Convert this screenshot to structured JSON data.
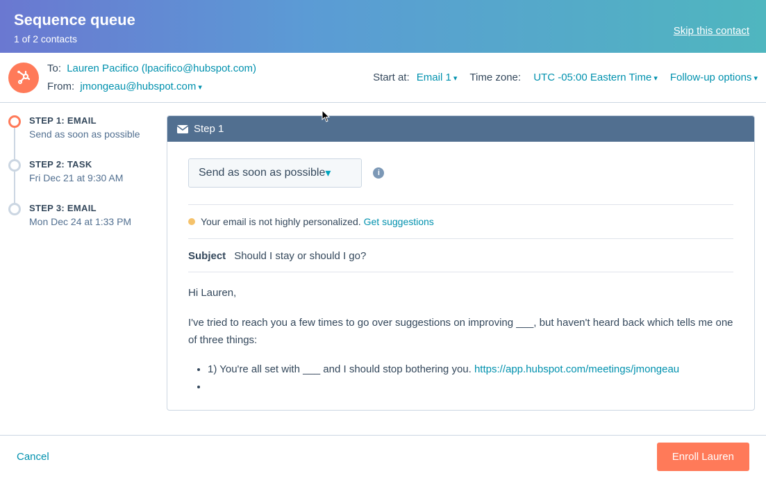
{
  "header": {
    "title": "Sequence queue",
    "subtitle": "1 of 2 contacts",
    "skip": "Skip this contact"
  },
  "meta": {
    "to_label": "To:",
    "to_value": "Lauren Pacifico (lpacifico@hubspot.com)",
    "from_label": "From:",
    "from_value": "jmongeau@hubspot.com",
    "start_at_label": "Start at:",
    "start_at_value": "Email 1",
    "timezone_label": "Time zone:",
    "timezone_value": "UTC -05:00 Eastern Time",
    "followup_label": "Follow-up options"
  },
  "steps": [
    {
      "title": "STEP 1: EMAIL",
      "sub": "Send as soon as possible",
      "active": true
    },
    {
      "title": "STEP 2: TASK",
      "sub": "Fri Dec 21 at 9:30 AM",
      "active": false
    },
    {
      "title": "STEP 3: EMAIL",
      "sub": "Mon Dec 24 at 1:33 PM",
      "active": false
    }
  ],
  "editor": {
    "panel_title": "Step 1",
    "timing_select": "Send as soon as possible",
    "personalize_msg": "Your email is not highly personalized.",
    "suggestions_link": "Get suggestions",
    "subject_label": "Subject",
    "subject_value": "Should I stay or should I go?",
    "body": {
      "greeting": "Hi Lauren,",
      "para1": "I've tried to reach you a few times to go over suggestions on improving ___, but haven't heard back which tells me one of three things:",
      "bullet1_text": "1) You're all set with ___ and I should stop bothering you. ",
      "bullet1_link": "https://app.hubspot.com/meetings/jmongeau"
    }
  },
  "footer": {
    "cancel": "Cancel",
    "enroll": "Enroll Lauren"
  }
}
